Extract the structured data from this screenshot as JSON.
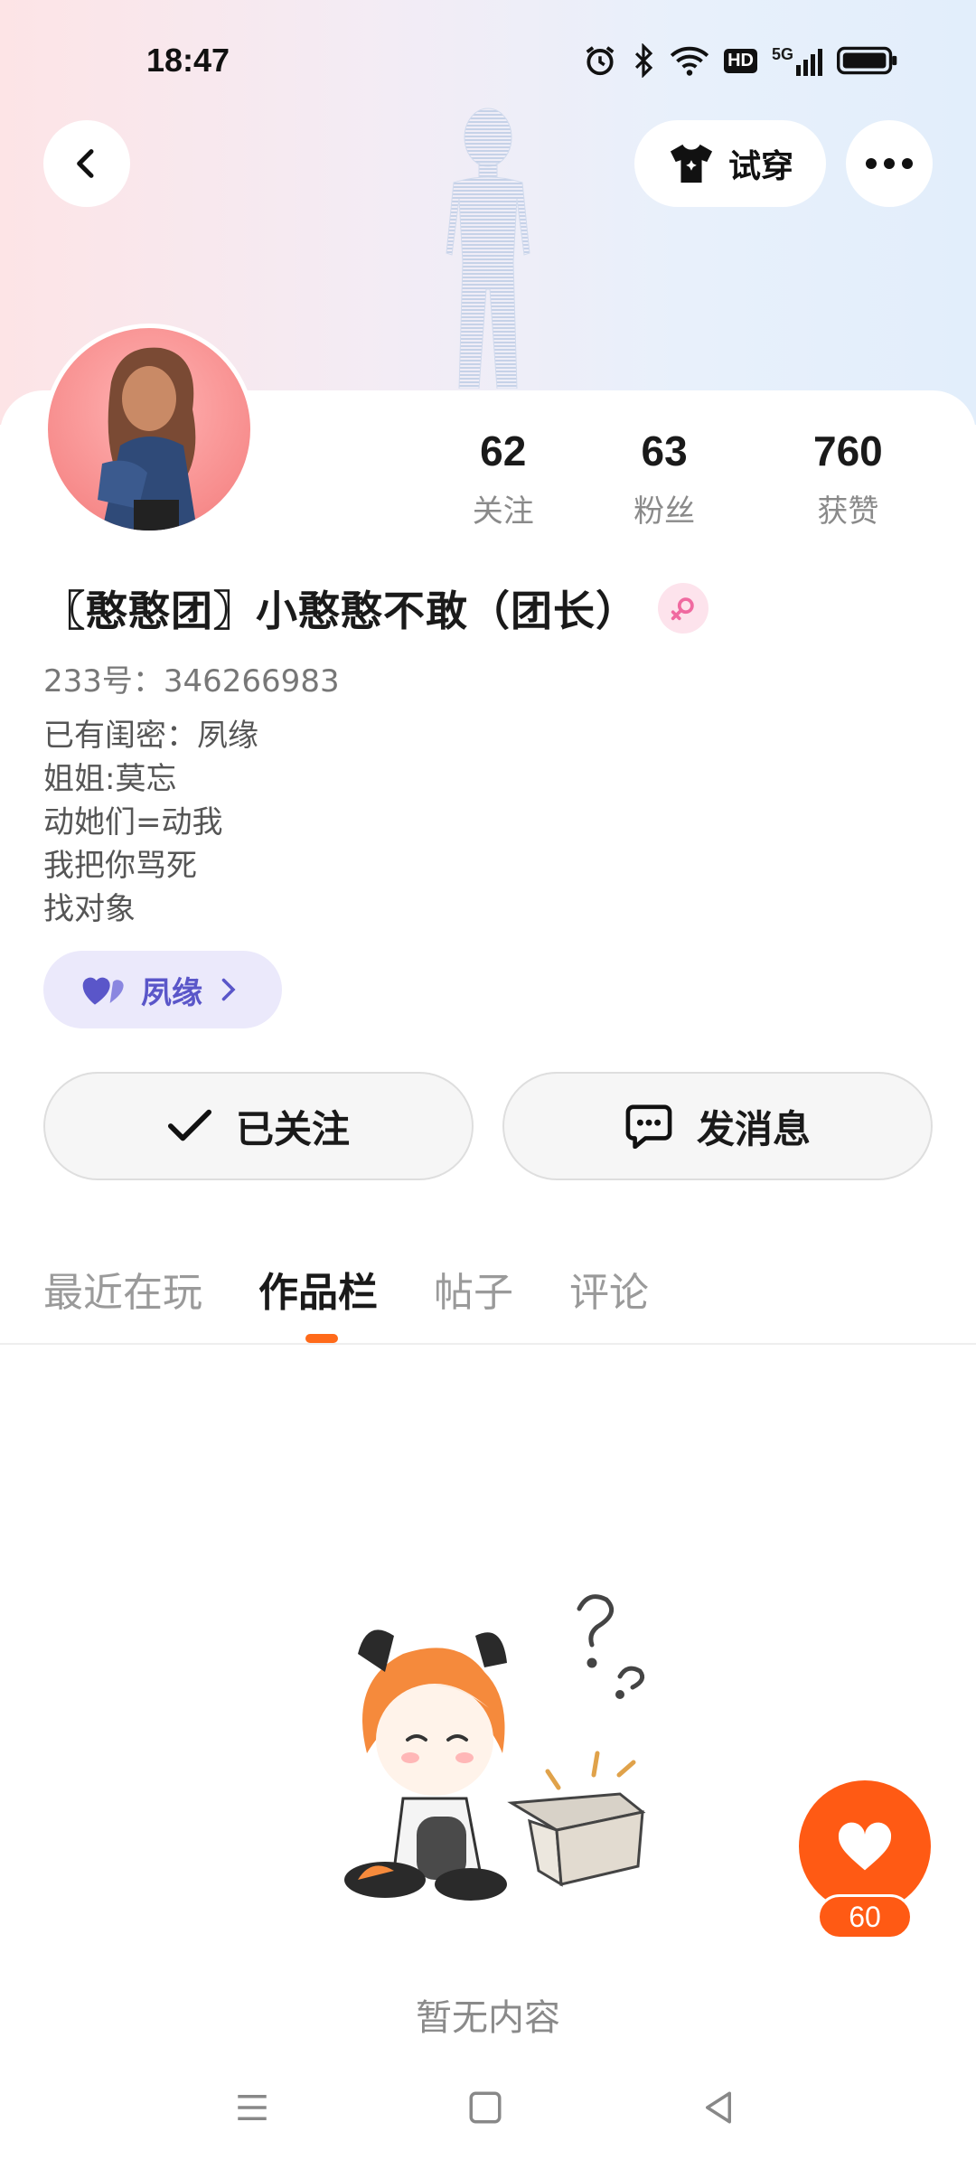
{
  "status_bar": {
    "time": "18:47",
    "icons": [
      "alarm-icon",
      "bluetooth-icon",
      "wifi-icon",
      "hd-icon",
      "5g-signal-icon",
      "battery-icon"
    ],
    "hd_label": "HD",
    "network_label": "5G"
  },
  "header": {
    "back_icon": "chevron-left-icon",
    "try_on_label": "试穿",
    "try_on_icon": "tshirt-icon",
    "more_icon": "more-horizontal-icon"
  },
  "profile": {
    "stats": [
      {
        "value": "62",
        "label": "关注"
      },
      {
        "value": "63",
        "label": "粉丝"
      },
      {
        "value": "760",
        "label": "获赞"
      }
    ],
    "username": "〖憨憨团〗小憨憨不敢（团长）",
    "gender_icon": "female-icon",
    "uid": "233号：346266983",
    "bio": [
      "已有闺密：夙缘",
      "姐姐:莫忘",
      "动她们=动我",
      "我把你骂死",
      "找对象"
    ],
    "bestie_chip": {
      "label": "夙缘",
      "icon": "hearts-icon",
      "arrow_icon": "chevron-right-icon"
    }
  },
  "actions": {
    "follow_label": "已关注",
    "follow_icon": "check-icon",
    "message_label": "发消息",
    "message_icon": "chat-bubble-icon"
  },
  "tabs": [
    {
      "label": "最近在玩",
      "active": false
    },
    {
      "label": "作品栏",
      "active": true
    },
    {
      "label": "帖子",
      "active": false
    },
    {
      "label": "评论",
      "active": false
    }
  ],
  "content": {
    "empty_text": "暂无内容"
  },
  "like_fab": {
    "icon": "heart-icon",
    "count": "60"
  },
  "colors": {
    "accent": "#ff5a14",
    "bestie_chip_bg": "#ebe9fb",
    "bestie_text": "#5a56c9"
  }
}
